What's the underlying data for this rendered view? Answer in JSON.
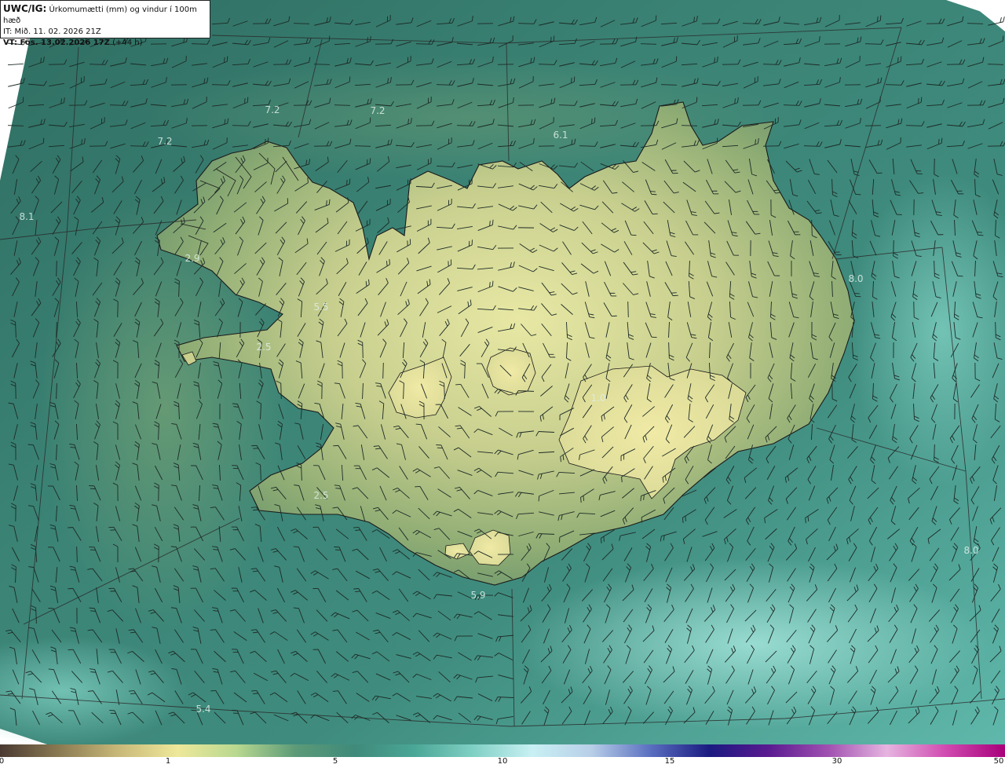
{
  "header": {
    "product": "UWC/IG:",
    "description": "Úrkomumætti (mm) og vindur í 100m hæð",
    "issue_time": "IT: Mið. 11. 02. 2026 21Z",
    "valid_label": "VT: Fös. 13.02.2026 17Z",
    "lead": "(+44 h)"
  },
  "map_values": [
    "7.2",
    "7.2",
    "7.2",
    "6.1",
    "8.1",
    "2.9",
    "5.5",
    "2.5",
    "1.0",
    "8.0",
    "2.5",
    "5.9",
    "8.0",
    "5.4"
  ],
  "colorbar": {
    "ticks": [
      "0",
      "1",
      "5",
      "10",
      "15",
      "30",
      "50"
    ],
    "colors": [
      "#4a3a32",
      "#8a7a52",
      "#c8b878",
      "#eee89a",
      "#b8d890",
      "#5c9a78",
      "#3f8a7a",
      "#4aa696",
      "#7fd0c4",
      "#c8f0f4",
      "#b8cfe8",
      "#5a6fc0",
      "#1a1a80",
      "#5a1a90",
      "#a050b0",
      "#e6b4e0",
      "#d04ab0",
      "#a8007a"
    ],
    "low_color": "#4a3a32",
    "high_color": "#a8007a"
  },
  "palette": {
    "sea_dark": "#2e6e66",
    "sea_mid": "#3f8a7a",
    "sea_light": "#7ccfc2",
    "land_low": "#7c9e6e",
    "land_high": "#dfe2a0",
    "coast_line": "#1a1a1a",
    "grid_line": "#2c2c2c"
  }
}
